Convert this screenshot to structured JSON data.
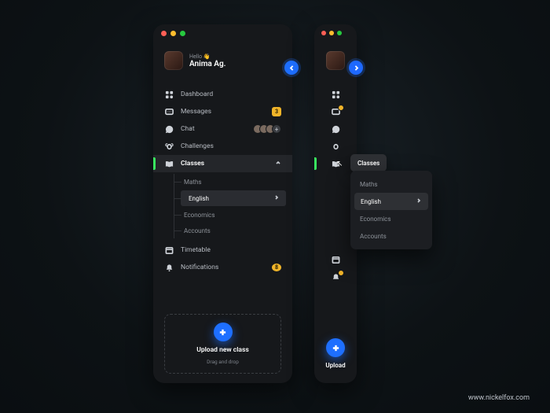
{
  "user": {
    "greeting": "Hello 👋",
    "name": "Anima Ag."
  },
  "nav": {
    "dashboard": "Dashboard",
    "messages": {
      "label": "Messages",
      "badge": "3"
    },
    "chat": "Chat",
    "challenges": "Challenges",
    "classes": "Classes",
    "timetable": "Timetable",
    "notifications": {
      "label": "Notifications",
      "badge": "8"
    }
  },
  "classes_children": {
    "maths": "Maths",
    "english": "English",
    "economics": "Economics",
    "accounts": "Accounts"
  },
  "upload": {
    "title": "Upload new class",
    "subtitle": "Drag and drop",
    "short": "Upload"
  },
  "tooltip_classes": "Classes",
  "credit": "www.nickelfox.com"
}
